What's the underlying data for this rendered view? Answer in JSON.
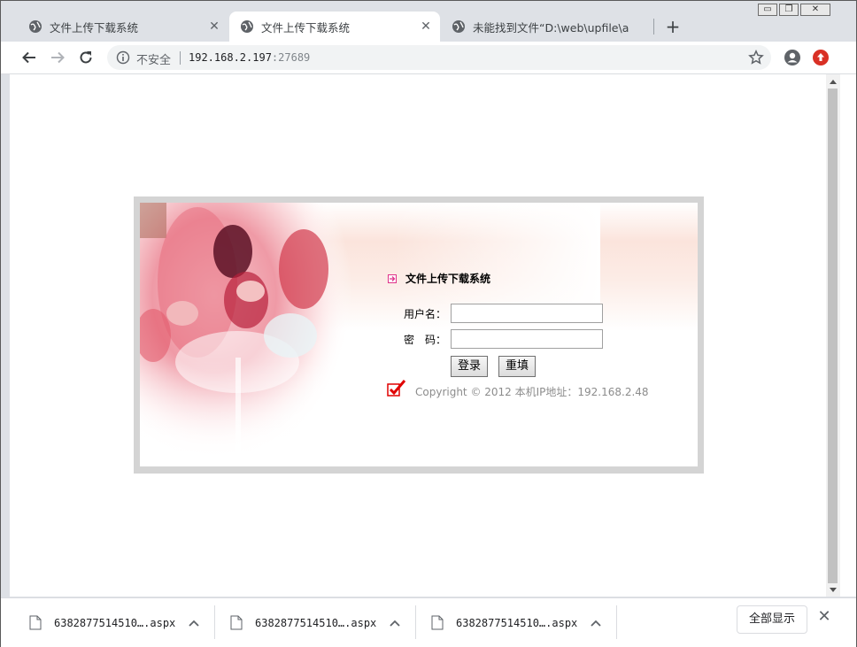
{
  "tabs": [
    {
      "title": "文件上传下载系统",
      "active": false
    },
    {
      "title": "文件上传下载系统",
      "active": true
    },
    {
      "title": "未能找到文件“D:\\web\\upfile\\a",
      "active": false
    }
  ],
  "window_controls": {
    "minimize": "▭",
    "maximize": "❐",
    "close": "✕"
  },
  "toolbar": {
    "security_label": "不安全",
    "url_host": "192.168.2.197",
    "url_port": ":27689"
  },
  "login": {
    "title": "文件上传下载系统",
    "username_label": "用户名：",
    "password_label": "密　码：",
    "username_value": "",
    "password_value": "",
    "login_button": "登录",
    "reset_button": "重填",
    "copyright": "Copyright © 2012 本机IP地址：192.168.2.48"
  },
  "downloads": {
    "items": [
      {
        "name": "6382877514510….aspx"
      },
      {
        "name": "6382877514510….aspx"
      },
      {
        "name": "6382877514510….aspx"
      }
    ],
    "show_all_label": "全部显示"
  },
  "icons": {
    "tab_favicon": "globe-icon",
    "back": "arrow-left-icon",
    "forward": "arrow-right-icon",
    "reload": "reload-icon",
    "info": "info-icon",
    "star": "star-icon",
    "profile": "profile-icon",
    "update": "update-icon",
    "file": "file-icon",
    "caret": "chevron-up-icon"
  },
  "colors": {
    "tabstrip": "#dee1e6",
    "update_badge": "#d93025",
    "frame_border": "#d4d4d4",
    "title_arrow": "#e0338a",
    "checkmark": "#e00000"
  }
}
